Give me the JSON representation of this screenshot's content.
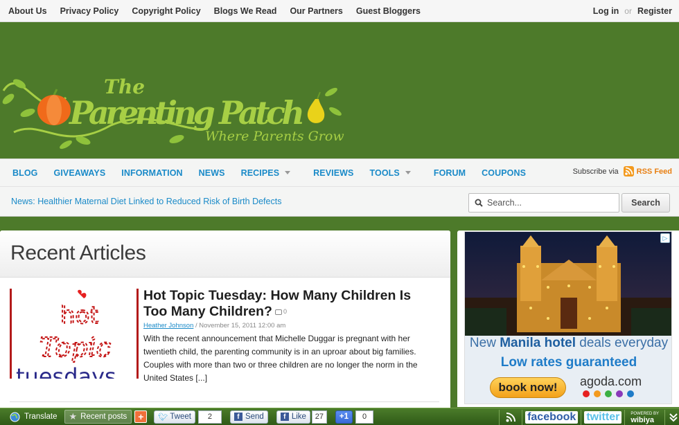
{
  "topbar": {
    "links": [
      "About Us",
      "Privacy Policy",
      "Copyright Policy",
      "Blogs We Read",
      "Our Partners",
      "Guest Bloggers"
    ],
    "login": "Log in",
    "or": "or",
    "register": "Register"
  },
  "logo": {
    "the": "The",
    "name": "Parenting Patch",
    "tagline": "Where Parents Grow"
  },
  "nav": {
    "items": [
      {
        "label": "BLOG",
        "dropdown": false
      },
      {
        "label": "GIVEAWAYS",
        "dropdown": false
      },
      {
        "label": "INFORMATION",
        "dropdown": false
      },
      {
        "label": "NEWS",
        "dropdown": false
      },
      {
        "label": "RECIPES",
        "dropdown": true
      },
      {
        "label": "REVIEWS",
        "dropdown": false
      },
      {
        "label": "TOOLS",
        "dropdown": true
      },
      {
        "label": "FORUM",
        "dropdown": false
      },
      {
        "label": "COUPONS",
        "dropdown": false
      }
    ],
    "subscribe_text": "Subscribe via",
    "rss_label": "RSS Feed",
    "news_ticker": "News: Healthier Maternal Diet Linked to Reduced Risk of Birth Defects",
    "search_placeholder": "Search...",
    "search_button": "Search"
  },
  "main": {
    "heading": "Recent Articles",
    "article": {
      "title": "Hot Topic Tuesday: How Many Children Is Too Many Children?",
      "comments": "0",
      "author": "Heather Johnson",
      "date": " / November 15, 2011 12:00 am",
      "excerpt": "With the recent announcement that Michelle Duggar is pregnant with her twentieth child, the parenting community is in an uproar about big families. Couples with more than two or three children are no longer the norm in the United States [...]",
      "thumb_line1": "hot",
      "thumb_line2": "Topic",
      "thumb_line3": "tuesdays"
    }
  },
  "ad": {
    "line1_pre": "New ",
    "line1_bold": "Manila hotel",
    "line1_post": " deals everyday",
    "line2": "Low rates guaranteed",
    "button": "book now!",
    "brand": "agoda.com",
    "dot_colors": [
      "#e62020",
      "#f39a1e",
      "#3cb043",
      "#8a3ab9",
      "#1f7cc8"
    ]
  },
  "toolbar": {
    "translate": "Translate",
    "recent": "Recent posts",
    "tweet": "Tweet",
    "tweet_count": "2",
    "send": "Send",
    "like": "Like",
    "like_count": "27",
    "plusone": "+1",
    "plusone_count": "0",
    "facebook": "facebook",
    "twitter": "twitter",
    "powered": "POWERED BY",
    "wibiya": "wibiya"
  },
  "colors": {
    "header_green": "#4d7a2a",
    "nav_blue": "#1a8ac8",
    "rss_orange": "#e87f12"
  }
}
